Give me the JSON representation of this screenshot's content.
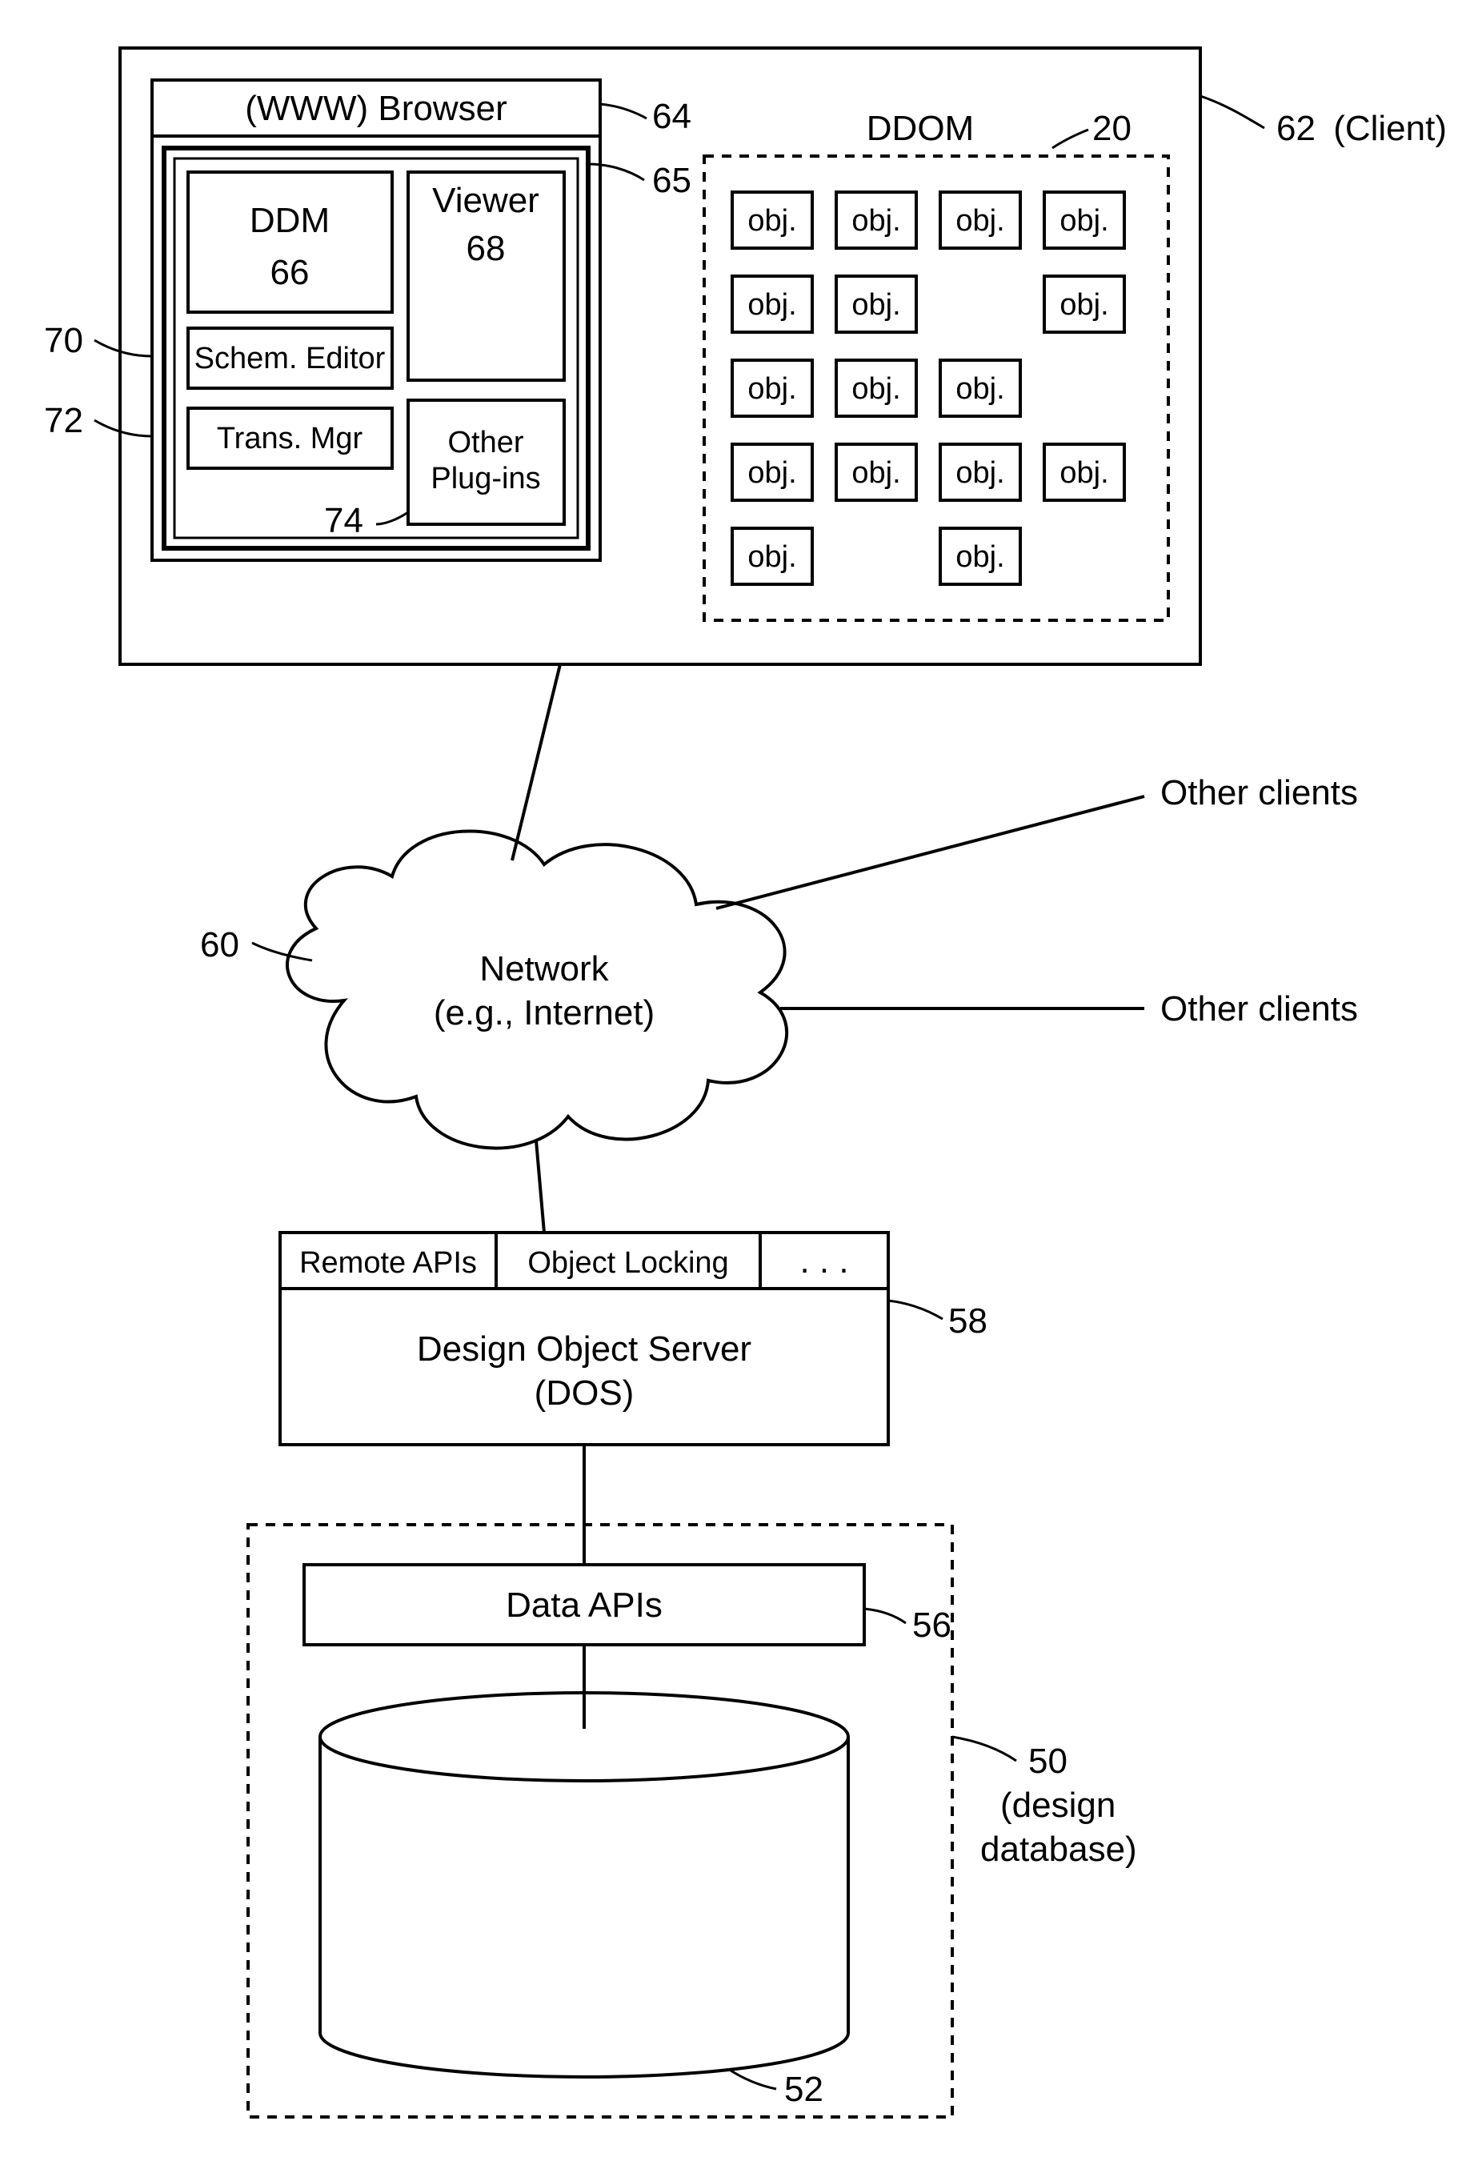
{
  "refs": {
    "client": {
      "num": "62",
      "suffix": "(Client)"
    },
    "browser": {
      "num": "64",
      "title": "(WWW) Browser"
    },
    "pluginArea": {
      "num": "65"
    },
    "ddm": {
      "num": "66",
      "label1": "DDM"
    },
    "viewer": {
      "num": "68",
      "label": "Viewer"
    },
    "schem": {
      "num": "70",
      "label": "Schem. Editor"
    },
    "trans": {
      "num": "72",
      "label": "Trans. Mgr"
    },
    "otherPlug": {
      "num": "74",
      "label1": "Other",
      "label2": "Plug-ins"
    },
    "ddom": {
      "num": "20",
      "title": "DDOM"
    },
    "objText": "obj.",
    "network": {
      "num": "60",
      "label1": "Network",
      "label2": "(e.g., Internet)"
    },
    "otherClients1": "Other clients",
    "otherClients2": "Other clients",
    "dos": {
      "num": "58",
      "remote": "Remote APIs",
      "lock": "Object Locking",
      "dots": ". . .",
      "label1": "Design Object Server",
      "label2": "(DOS)"
    },
    "dataApis": {
      "num": "56",
      "label": "Data APIs"
    },
    "db": {
      "num": "50",
      "paren1": "(design",
      "paren2": "database)",
      "cylNum": "52"
    }
  }
}
